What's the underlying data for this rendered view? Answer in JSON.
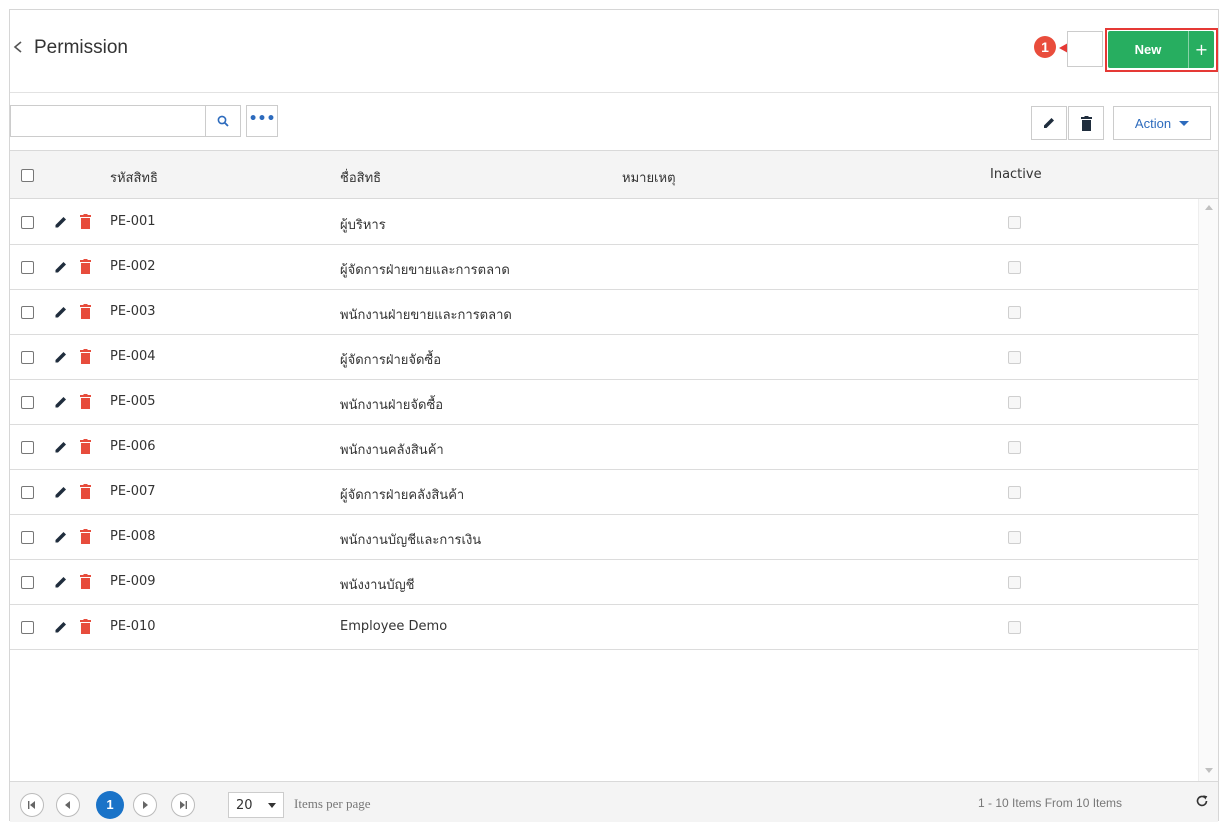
{
  "header": {
    "title": "Permission",
    "annotation_number": "1",
    "new_label": "New",
    "new_plus": "+"
  },
  "toolbar": {
    "search_placeholder": "",
    "more_label": "•••",
    "action_label": "Action"
  },
  "grid": {
    "columns": {
      "code": "รหัสสิทธิ",
      "name": "ชื่อสิทธิ",
      "remark": "หมายเหตุ",
      "inactive": "Inactive"
    },
    "rows": [
      {
        "code": "PE-001",
        "name": "ผู้บริหาร",
        "remark": "",
        "inactive": false
      },
      {
        "code": "PE-002",
        "name": "ผู้จัดการฝ่ายขายและการตลาด",
        "remark": "",
        "inactive": false
      },
      {
        "code": "PE-003",
        "name": "พนักงานฝ่ายขายและการตลาด",
        "remark": "",
        "inactive": false
      },
      {
        "code": "PE-004",
        "name": "ผู้จัดการฝ่ายจัดซื้อ",
        "remark": "",
        "inactive": false
      },
      {
        "code": "PE-005",
        "name": "พนักงานฝ่ายจัดซื้อ",
        "remark": "",
        "inactive": false
      },
      {
        "code": "PE-006",
        "name": "พนักงานคลังสินค้า",
        "remark": "",
        "inactive": false
      },
      {
        "code": "PE-007",
        "name": "ผู้จัดการฝ่ายคลังสินค้า",
        "remark": "",
        "inactive": false
      },
      {
        "code": "PE-008",
        "name": "พนักงานบัญชีและการเงิน",
        "remark": "",
        "inactive": false
      },
      {
        "code": "PE-009",
        "name": "พนังงานบัญชี",
        "remark": "",
        "inactive": false
      },
      {
        "code": "PE-010",
        "name": "Employee Demo",
        "remark": "",
        "inactive": false
      }
    ]
  },
  "pager": {
    "current_page": "1",
    "page_size": "20",
    "page_size_label": "Items per page",
    "summary": "1 - 10 Items From 10 Items"
  },
  "colors": {
    "accent_blue": "#1a73c8",
    "new_button": "#27ae60",
    "delete_red": "#e74c3c",
    "annotation_red": "#e53935"
  }
}
